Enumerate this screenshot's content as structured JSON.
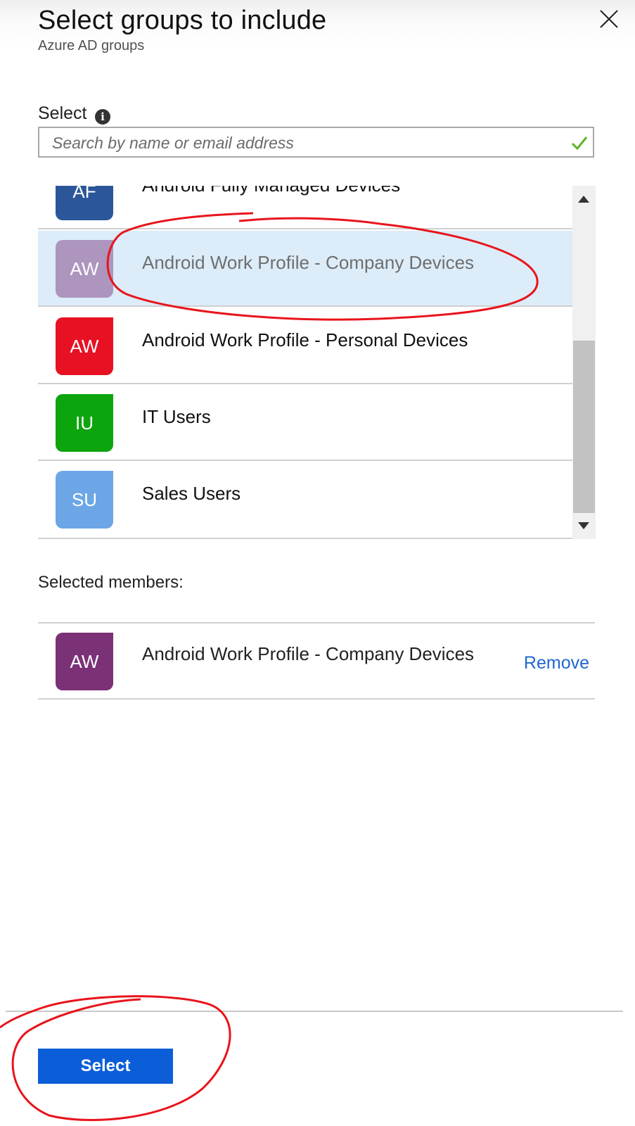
{
  "header": {
    "title": "Select groups to include",
    "subtitle": "Azure AD groups",
    "close_icon": "close-icon"
  },
  "search": {
    "label": "Select",
    "info_icon": "info-icon",
    "info_glyph": "i",
    "placeholder": "Search by name or email address",
    "value": "",
    "valid_icon": "checkmark-icon"
  },
  "groups": [
    {
      "initials": "AF",
      "name": "Android Fully Managed Devices",
      "color": "#2b579a",
      "selected": false
    },
    {
      "initials": "AW",
      "name": "Android Work Profile - Company Devices",
      "color": "#ad95bd",
      "selected": true
    },
    {
      "initials": "AW",
      "name": "Android Work Profile - Personal Devices",
      "color": "#e81123",
      "selected": false
    },
    {
      "initials": "IU",
      "name": "IT Users",
      "color": "#0da50d",
      "selected": false
    },
    {
      "initials": "SU",
      "name": "Sales Users",
      "color": "#6ca6e6",
      "selected": false
    }
  ],
  "selected_members": {
    "heading": "Selected members:",
    "items": [
      {
        "initials": "AW",
        "name": "Android Work Profile - Company Devices",
        "color": "#7b3176",
        "remove_label": "Remove"
      }
    ]
  },
  "footer": {
    "select_label": "Select"
  },
  "colors": {
    "accent": "#0b5ed7",
    "selected_row": "#dcecf9",
    "link": "#1f66d1",
    "annotation": "#e8141b"
  }
}
